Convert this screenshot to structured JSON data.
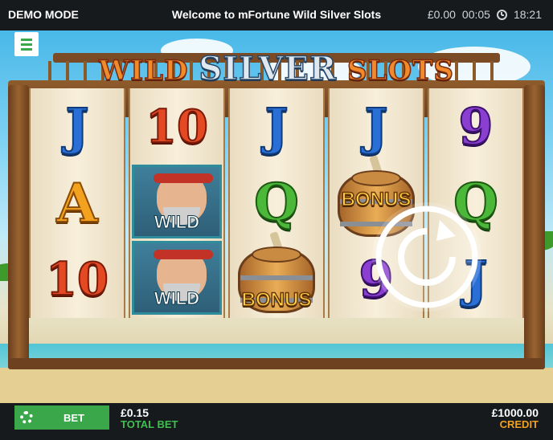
{
  "status_bar": {
    "mode": "DEMO MODE",
    "title": "Welcome to mFortune Wild Silver Slots",
    "balance": "£0.00",
    "session_time": "00:05",
    "clock": "18:21",
    "clock_icon": "clock-icon"
  },
  "game": {
    "logo_word1": "WILD",
    "logo_word2": "SILVER",
    "logo_word3": "SLOTS",
    "reels": [
      {
        "symbols": [
          "J",
          "A",
          "10"
        ]
      },
      {
        "symbols": [
          "10",
          "WILD",
          "WILD"
        ]
      },
      {
        "symbols": [
          "J",
          "Q",
          "BONUS"
        ]
      },
      {
        "symbols": [
          "J",
          "BONUS",
          "9"
        ]
      },
      {
        "symbols": [
          "9",
          "Q",
          "J"
        ]
      }
    ],
    "wild_label": "WILD",
    "bonus_label": "BONUS",
    "menu_icon": "hamburger-icon",
    "spin_icon": "spin-arrow-icon"
  },
  "footer": {
    "settings_icon": "gear-icon",
    "bet_button": "BET",
    "total_bet_value": "£0.15",
    "total_bet_label": "TOTAL BET",
    "credit_value": "£1000.00",
    "credit_label": "CREDIT"
  },
  "colors": {
    "accent_green": "#3aa84a",
    "credit_orange": "#f0a020",
    "bar_background": "#161a1d"
  }
}
